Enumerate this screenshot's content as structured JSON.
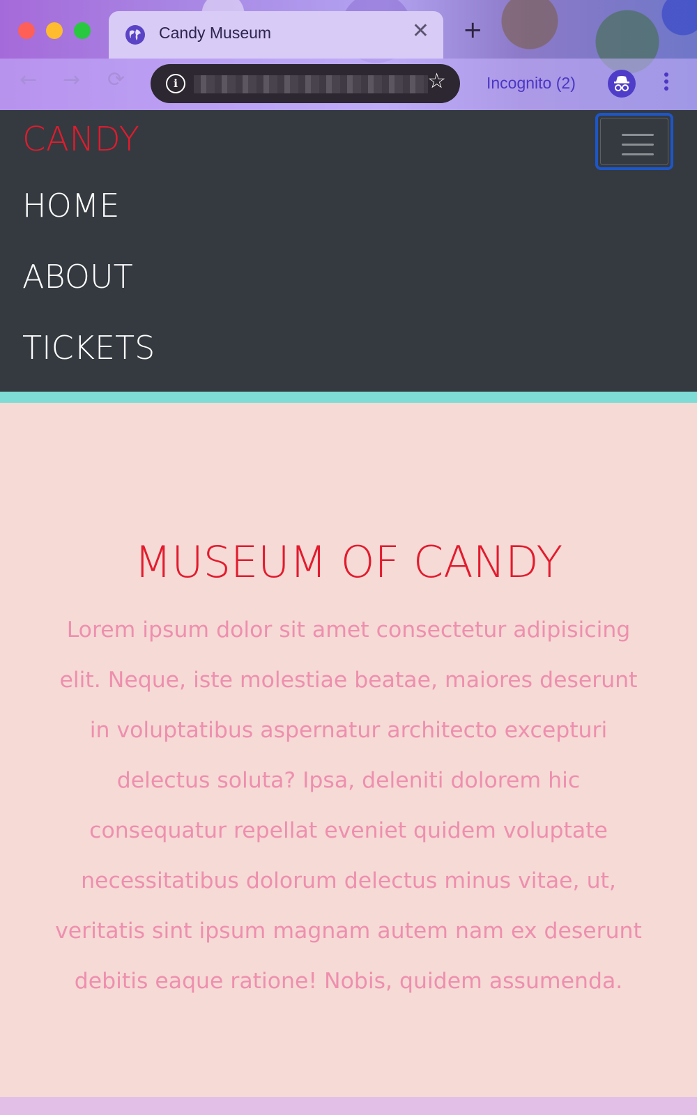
{
  "browser": {
    "tab_title": "Candy Museum",
    "tab_close": "✕",
    "new_tab": "+",
    "nav_back": "←",
    "nav_forward": "→",
    "nav_reload": "⟳",
    "info_glyph": "i",
    "star_glyph": "☆",
    "incognito_label": "Incognito (2)",
    "accent_color": "#4b36c4"
  },
  "site": {
    "brand": "CANDY",
    "nav": {
      "home": "HOME",
      "about": "ABOUT",
      "tickets": "TICKETS"
    },
    "colors": {
      "navbar_bg": "#343a40",
      "brand": "#e31b2d",
      "hero_bg": "#f5dad6",
      "hero_text": "#ee8fae",
      "teal_band": "#7fdbd5"
    }
  },
  "hero": {
    "title": "MUSEUM OF CANDY",
    "body": "Lorem ipsum dolor sit amet consectetur adipisicing elit. Neque, iste molestiae beatae, maiores deserunt in voluptatibus aspernatur architecto excepturi delectus soluta? Ipsa, deleniti dolorem hic consequatur repellat eveniet quidem voluptate necessitatibus dolorum delectus minus vitae, ut, veritatis sint ipsum magnam autem nam ex deserunt debitis eaque ratione! Nobis, quidem assumenda."
  },
  "icons": {
    "favicon": "globe-icon",
    "info": "info-icon",
    "star": "star-icon",
    "incognito": "incognito-icon",
    "menu": "kebab-menu-icon",
    "toggler": "hamburger-icon"
  }
}
